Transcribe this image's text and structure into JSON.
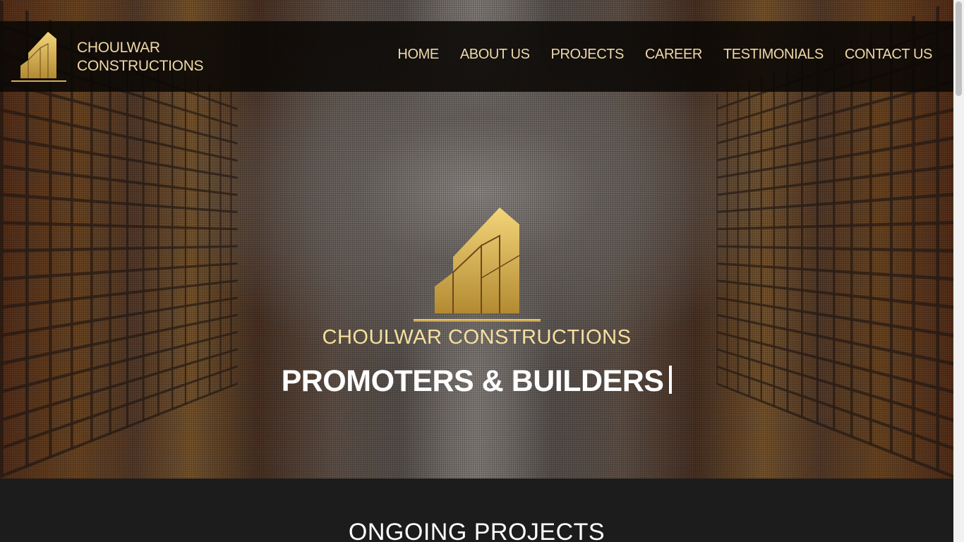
{
  "brand": {
    "name_line1": "CHOULWAR",
    "name_line2": "CONSTRUCTIONS",
    "logo_icon": "building-logo-icon",
    "gold_light": "#f3d57a",
    "gold_dark": "#b38a32"
  },
  "nav": {
    "items": [
      {
        "label": "HOME"
      },
      {
        "label": "ABOUT US"
      },
      {
        "label": "PROJECTS"
      },
      {
        "label": "CAREER"
      },
      {
        "label": "TESTIMONIALS"
      },
      {
        "label": "CONTACT US"
      }
    ]
  },
  "hero": {
    "company": "CHOULWAR CONSTRUCTIONS",
    "tagline": "PROMOTERS & BUILDERS"
  },
  "projects": {
    "heading": "ONGOING PROJECTS"
  }
}
